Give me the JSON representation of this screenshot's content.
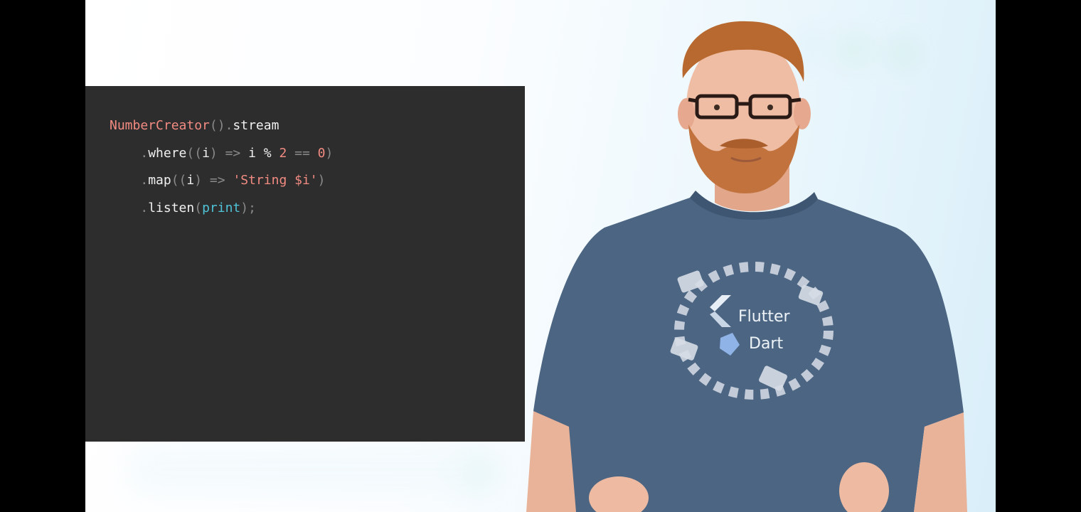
{
  "code": {
    "lines": [
      [
        {
          "t": "NumberCreator",
          "k": "class"
        },
        {
          "t": "().",
          "k": "punc"
        },
        {
          "t": "stream",
          "k": "ident"
        }
      ],
      [
        {
          "t": "    ",
          "k": "punc"
        },
        {
          "t": ".",
          "k": "punc"
        },
        {
          "t": "where",
          "k": "ident"
        },
        {
          "t": "((",
          "k": "punc"
        },
        {
          "t": "i",
          "k": "ident"
        },
        {
          "t": ") => ",
          "k": "punc"
        },
        {
          "t": "i",
          "k": "ident"
        },
        {
          "t": " % ",
          "k": "ident"
        },
        {
          "t": "2",
          "k": "num"
        },
        {
          "t": " == ",
          "k": "punc"
        },
        {
          "t": "0",
          "k": "num"
        },
        {
          "t": ")",
          "k": "punc"
        }
      ],
      [
        {
          "t": "    ",
          "k": "punc"
        },
        {
          "t": ".",
          "k": "punc"
        },
        {
          "t": "map",
          "k": "ident"
        },
        {
          "t": "((",
          "k": "punc"
        },
        {
          "t": "i",
          "k": "ident"
        },
        {
          "t": ") => ",
          "k": "punc"
        },
        {
          "t": "'String $i'",
          "k": "str"
        },
        {
          "t": ")",
          "k": "punc"
        }
      ],
      [
        {
          "t": "    ",
          "k": "punc"
        },
        {
          "t": ".",
          "k": "punc"
        },
        {
          "t": "listen",
          "k": "ident"
        },
        {
          "t": "(",
          "k": "punc"
        },
        {
          "t": "print",
          "k": "fn"
        },
        {
          "t": ");",
          "k": "punc"
        }
      ]
    ]
  },
  "shirt": {
    "brand_1": "Flutter",
    "brand_2": "Dart"
  },
  "colors": {
    "code_bg": "#2d2d2d",
    "class": "#f28b82",
    "function": "#4fc3d7",
    "text": "#f0f0f0",
    "punctuation": "#8a8a8a",
    "shirt": "#4b6582",
    "hair": "#b8692f"
  }
}
